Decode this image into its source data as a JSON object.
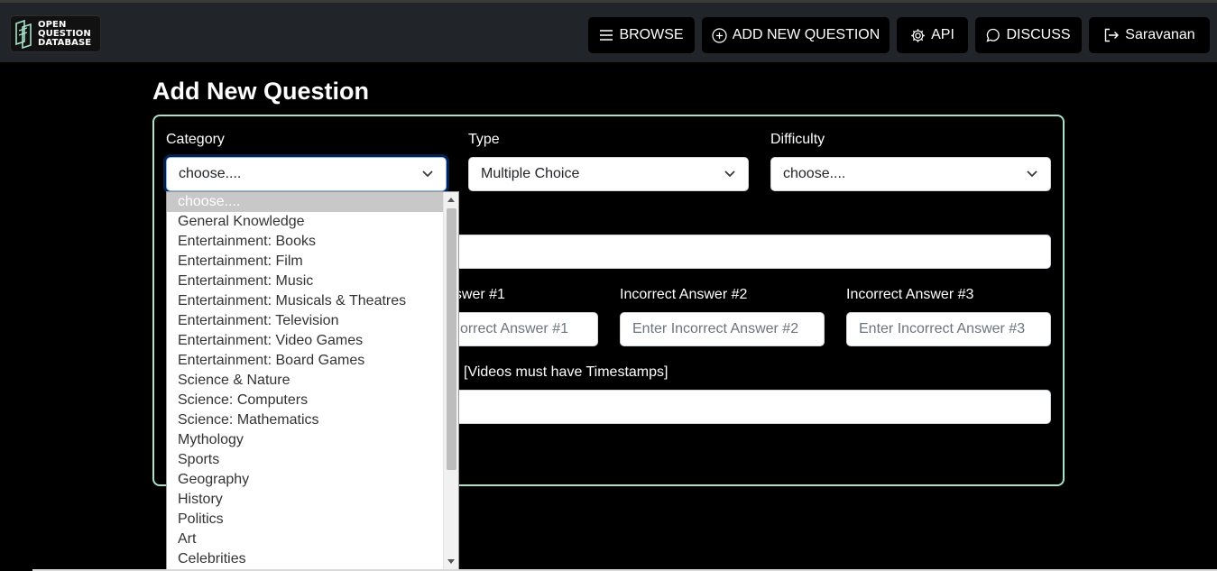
{
  "logo": {
    "line1": "OPEN",
    "line2": "QUESTION",
    "line3": "DATABASE"
  },
  "nav": {
    "browse": "BROWSE",
    "add_new": "ADD NEW QUESTION",
    "api": "API",
    "discuss": "DISCUSS",
    "user": "Saravanan"
  },
  "page_title": "Add New Question",
  "form": {
    "category": {
      "label": "Category",
      "value": "choose...."
    },
    "type": {
      "label": "Type",
      "value": "Multiple Choice"
    },
    "difficulty": {
      "label": "Difficulty",
      "value": "choose...."
    },
    "incorrect1": {
      "label_partial": "nswer #1",
      "placeholder_partial": "orrect Answer #1"
    },
    "incorrect2": {
      "label": "Incorrect Answer #2",
      "placeholder": "Enter Incorrect Answer #2"
    },
    "incorrect3": {
      "label": "Incorrect Answer #3",
      "placeholder": "Enter Incorrect Answer #3"
    },
    "source_label_partial": "[Videos must have Timestamps]"
  },
  "category_options": [
    "choose....",
    "General Knowledge",
    "Entertainment: Books",
    "Entertainment: Film",
    "Entertainment: Music",
    "Entertainment: Musicals & Theatres",
    "Entertainment: Television",
    "Entertainment: Video Games",
    "Entertainment: Board Games",
    "Science & Nature",
    "Science: Computers",
    "Science: Mathematics",
    "Mythology",
    "Sports",
    "Geography",
    "History",
    "Politics",
    "Art",
    "Celebrities"
  ],
  "colors": {
    "card_border": "#a8e2cc",
    "topbar": "#212529",
    "focus": "#86b7fe"
  }
}
